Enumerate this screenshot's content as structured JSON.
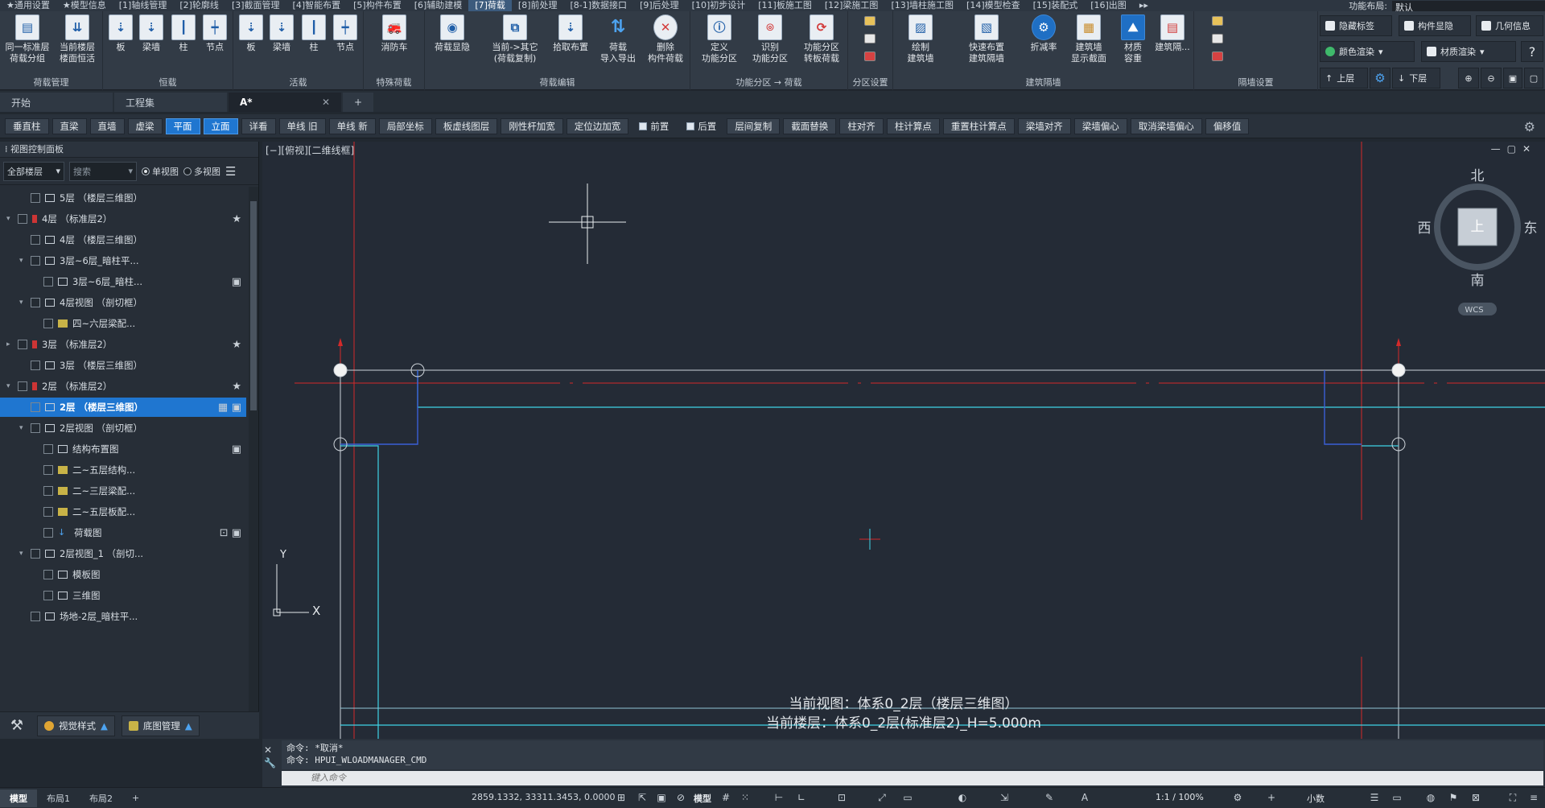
{
  "menubar": {
    "items": [
      "★通用设置",
      "★模型信息",
      "[1]轴线管理",
      "[2]轮廓线",
      "[3]截面管理",
      "[4]智能布置",
      "[5]构件布置",
      "[6]辅助建模",
      "[7]荷载",
      "[8]前处理",
      "[8-1]数据接口",
      "[9]后处理",
      "[10]初步设计",
      "[11]板施工图",
      "[12]梁施工图",
      "[13]墙柱施工图",
      "[14]模型检查",
      "[15]装配式",
      "[16]出图"
    ],
    "active_index": 8,
    "overflow": "▸▸",
    "layout_label": "功能布局:",
    "layout_value": "默认"
  },
  "ribbon": {
    "groups": [
      {
        "label": "荷载管理",
        "buttons": [
          "同一标准层\n荷载分组",
          "当前楼层\n楼面恒活"
        ]
      },
      {
        "label": "恒载",
        "buttons": [
          "板",
          "梁墙",
          "柱",
          "节点"
        ]
      },
      {
        "label": "活载",
        "buttons": [
          "板",
          "梁墙",
          "柱",
          "节点"
        ]
      },
      {
        "label": "特殊荷载",
        "buttons": [
          "消防车"
        ]
      },
      {
        "label": "荷载编辑",
        "buttons": [
          "荷载显隐",
          "当前->其它\n(荷载复制)",
          "拾取布置",
          "荷载\n导入导出",
          "删除\n构件荷载"
        ]
      },
      {
        "label": "功能分区 → 荷载",
        "buttons": [
          "定义\n功能分区",
          "识别\n功能分区",
          "功能分区\n转板荷载"
        ]
      },
      {
        "label": "分区设置",
        "buttons": []
      },
      {
        "label": "建筑隔墙",
        "buttons": [
          "绘制\n建筑墙",
          "快速布置\n建筑隔墙",
          "折减率",
          "建筑墙\n显示截面",
          "材质\n容重",
          "建筑隔..."
        ]
      },
      {
        "label": "隔墙设置",
        "buttons": []
      }
    ],
    "side_buttons": [
      "隐藏标签",
      "构件显隐",
      "几何信息",
      "颜色渲染",
      "材质渲染",
      "上层",
      "下层"
    ]
  },
  "tabs": [
    {
      "label": "开始",
      "closable": false
    },
    {
      "label": "工程集",
      "closable": false
    },
    {
      "label": "A*",
      "closable": true
    }
  ],
  "toolbar": {
    "buttons": [
      "垂直柱",
      "直梁",
      "直墙",
      "虚梁",
      "平面",
      "立面",
      "详看",
      "单线 旧",
      "单线 新",
      "局部坐标",
      "板虚线图层",
      "刚性杆加宽",
      "定位边加宽",
      "前置",
      "后置",
      "层间复制",
      "截面替换",
      "柱对齐",
      "柱计算点",
      "重置柱计算点",
      "梁墙对齐",
      "梁墙偏心",
      "取消梁墙偏心",
      "偏移值"
    ],
    "active": [
      "平面",
      "立面"
    ]
  },
  "left_panel": {
    "title": "视图控制面板",
    "floor_select": "全部楼层",
    "search_placeholder": "搜索",
    "radio_single": "单视图",
    "radio_multi": "多视图",
    "tree": [
      {
        "label": "5层 （楼层三维图）",
        "indent": 1,
        "icon": "grid",
        "expand": "",
        "right": ""
      },
      {
        "label": "4层 （标准层2）",
        "indent": 0,
        "icon": "red",
        "expand": "▾",
        "right": "★"
      },
      {
        "label": "4层 （楼层三维图）",
        "indent": 1,
        "icon": "grid",
        "expand": "",
        "right": ""
      },
      {
        "label": "3层~6层_暗柱平...",
        "indent": 1,
        "icon": "grid",
        "expand": "▾",
        "right": ""
      },
      {
        "label": "3层~6层_暗柱...",
        "indent": 2,
        "icon": "doc",
        "expand": "",
        "right": "▣"
      },
      {
        "label": "4层视图 （剖切框）",
        "indent": 1,
        "icon": "grid",
        "expand": "▾",
        "right": ""
      },
      {
        "label": "四~六层梁配...",
        "indent": 2,
        "icon": "yel",
        "expand": "",
        "right": ""
      },
      {
        "label": "3层 （标准层2）",
        "indent": 0,
        "icon": "red",
        "expand": "▸",
        "right": "★"
      },
      {
        "label": "3层 （楼层三维图）",
        "indent": 1,
        "icon": "grid",
        "expand": "",
        "right": ""
      },
      {
        "label": "2层 （标准层2）",
        "indent": 0,
        "icon": "red",
        "expand": "▾",
        "right": "★"
      },
      {
        "label": "2层 （楼层三维图）",
        "indent": 1,
        "icon": "grid",
        "expand": "",
        "right": "▦ ▣",
        "selected": true
      },
      {
        "label": "2层视图 （剖切框）",
        "indent": 1,
        "icon": "grid",
        "expand": "▾",
        "right": ""
      },
      {
        "label": "结构布置图",
        "indent": 2,
        "icon": "grid",
        "expand": "",
        "right": "▣"
      },
      {
        "label": "二~五层结构...",
        "indent": 2,
        "icon": "yel",
        "expand": "",
        "right": ""
      },
      {
        "label": "二~三层梁配...",
        "indent": 2,
        "icon": "yel",
        "expand": "",
        "right": ""
      },
      {
        "label": "二~五层板配...",
        "indent": 2,
        "icon": "yel",
        "expand": "",
        "right": ""
      },
      {
        "label": "荷载图",
        "indent": 2,
        "icon": "load",
        "expand": "",
        "right": "⊡ ▣"
      },
      {
        "label": "2层视图_1 （剖切...",
        "indent": 1,
        "icon": "grid",
        "expand": "▾",
        "right": ""
      },
      {
        "label": "模板图",
        "indent": 2,
        "icon": "grid",
        "expand": "",
        "right": ""
      },
      {
        "label": "三维图",
        "indent": 2,
        "icon": "cube",
        "expand": "",
        "right": ""
      },
      {
        "label": "场地-2层_暗柱平...",
        "indent": 1,
        "icon": "grid",
        "expand": "",
        "right": ""
      }
    ],
    "bottom_buttons": [
      "视觉样式",
      "底图管理"
    ]
  },
  "canvas": {
    "view_label": "[−][俯视][二维线框]",
    "compass": {
      "north": "北",
      "south": "南",
      "east": "东",
      "west": "西",
      "center": "上",
      "wcs": "WCS"
    },
    "axis_y": "Y",
    "axis_x": "X",
    "current_view": "当前视图：体系0_2层（楼层三维图）",
    "current_floor": "当前楼层：体系0_2层(标准层2)_H=5.000m"
  },
  "command": {
    "line1": "命令: *取消*",
    "line2": "命令:  HPUI_WLOADMANAGER_CMD",
    "placeholder": "键入命令"
  },
  "status": {
    "layouts": [
      "模型",
      "布局1",
      "布局2"
    ],
    "coords": "2859.1332, 33311.3453, 0.0000",
    "model_label": "模型",
    "scale": "1:1 / 100%",
    "units": "小数"
  },
  "colors": {
    "accent": "#1f76d0",
    "grid_red": "#d42a2a",
    "member_cyan": "#3fd3e6",
    "member_blue": "#3a5fd6",
    "background": "#212830"
  }
}
